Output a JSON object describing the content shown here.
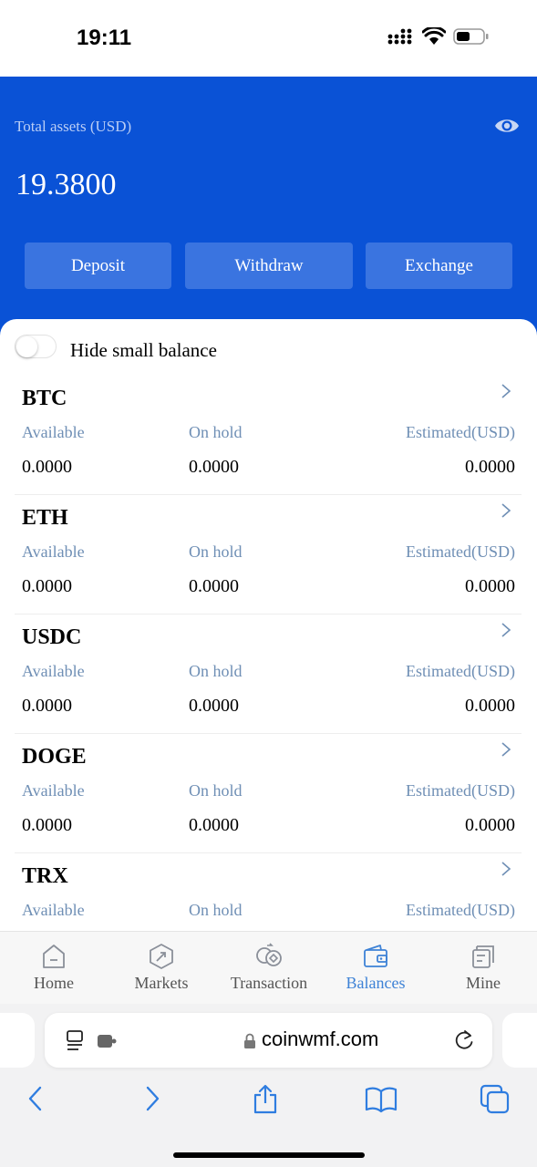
{
  "status_bar": {
    "time": "19:11"
  },
  "header": {
    "total_label": "Total assets (USD)",
    "total_value": "19.3800",
    "buttons": {
      "deposit": "Deposit",
      "withdraw": "Withdraw",
      "exchange": "Exchange"
    },
    "eye_icon": "eye-icon"
  },
  "filter": {
    "hide_small_label": "Hide small balance",
    "enabled": false
  },
  "columns": {
    "available": "Available",
    "on_hold": "On hold",
    "estimated": "Estimated(USD)"
  },
  "assets": [
    {
      "symbol": "BTC",
      "available": "0.0000",
      "on_hold": "0.0000",
      "estimated": "0.0000"
    },
    {
      "symbol": "ETH",
      "available": "0.0000",
      "on_hold": "0.0000",
      "estimated": "0.0000"
    },
    {
      "symbol": "USDC",
      "available": "0.0000",
      "on_hold": "0.0000",
      "estimated": "0.0000"
    },
    {
      "symbol": "DOGE",
      "available": "0.0000",
      "on_hold": "0.0000",
      "estimated": "0.0000"
    },
    {
      "symbol": "TRX",
      "available": "",
      "on_hold": "",
      "estimated": ""
    }
  ],
  "tabs": [
    {
      "label": "Home",
      "icon": "home-icon"
    },
    {
      "label": "Markets",
      "icon": "markets-icon"
    },
    {
      "label": "Transaction",
      "icon": "transaction-icon"
    },
    {
      "label": "Balances",
      "icon": "wallet-icon",
      "active": true
    },
    {
      "label": "Mine",
      "icon": "document-icon"
    }
  ],
  "browser": {
    "url": "coinwmf.com"
  },
  "colors": {
    "header_blue": "#0a52d6",
    "button_blue": "#3a74e0",
    "label_blue": "#6f8fb5",
    "active_tab": "#3e82d6"
  }
}
